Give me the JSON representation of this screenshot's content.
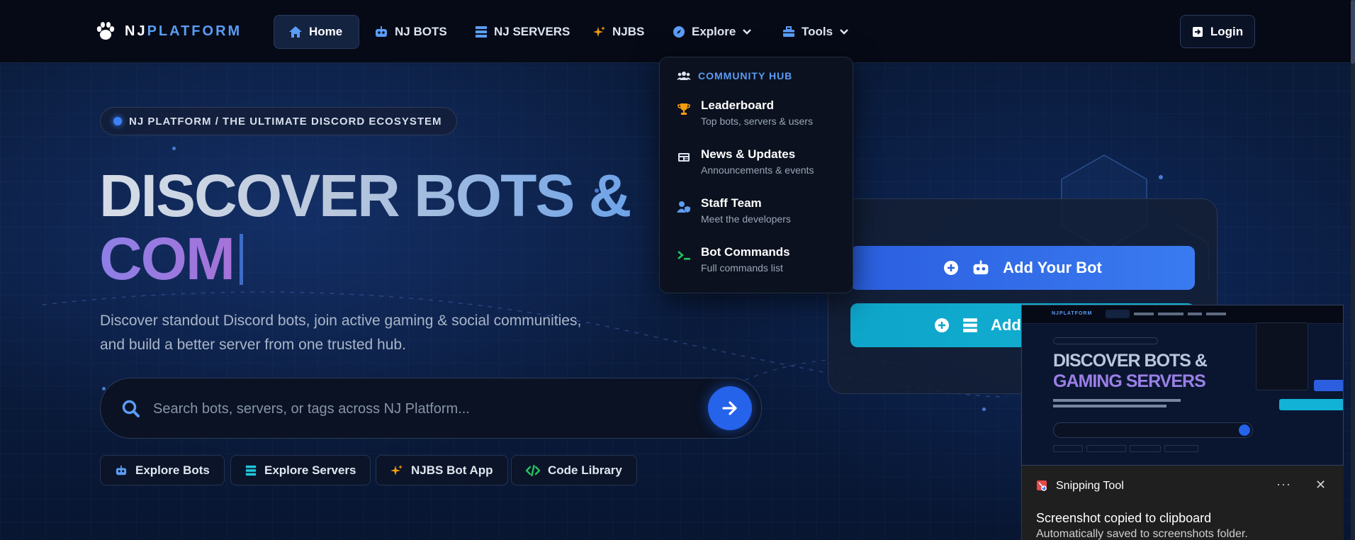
{
  "nav": {
    "logo_a": "NJ",
    "logo_b": "PLATFORM",
    "links": [
      {
        "label": "Home"
      },
      {
        "label": "NJ BOTS"
      },
      {
        "label": "NJ SERVERS"
      },
      {
        "label": "NJBS"
      },
      {
        "label": "Explore"
      },
      {
        "label": "Tools"
      }
    ],
    "login": "Login"
  },
  "hero": {
    "pill": "NJ PLATFORM / THE ULTIMATE DISCORD ECOSYSTEM",
    "line1": "DISCOVER BOTS &",
    "line2": "COM",
    "subtitle": "Discover standout Discord bots, join active gaming & social communities, and build a better server from one trusted hub.",
    "search_placeholder": "Search bots, servers, or tags across NJ Platform...",
    "chips": [
      {
        "label": "Explore Bots"
      },
      {
        "label": "Explore Servers"
      },
      {
        "label": "NJBS Bot App"
      },
      {
        "label": "Code Library"
      }
    ]
  },
  "dropdown": {
    "heading": "COMMUNITY HUB",
    "items": [
      {
        "title": "Leaderboard",
        "desc": "Top bots, servers & users"
      },
      {
        "title": "News & Updates",
        "desc": "Announcements & events"
      },
      {
        "title": "Staff Team",
        "desc": "Meet the developers"
      },
      {
        "title": "Bot Commands",
        "desc": "Full commands list"
      }
    ]
  },
  "card": {
    "add_bot": "Add Your Bot",
    "add_server": "Add"
  },
  "thumbnail": {
    "logo": "NJPLATFORM",
    "line1": "DISCOVER BOTS &",
    "line2": "GAMING SERVERS"
  },
  "toast": {
    "app": "Snipping Tool",
    "more": "···",
    "close": "✕",
    "message": "Screenshot copied to clipboard",
    "message2": "Automatically saved to screenshots folder."
  },
  "colors": {
    "accent": "#3b82f6",
    "brand_blue": "#5b9cf5",
    "cyan": "#12b2d6",
    "bg": "#071226"
  }
}
